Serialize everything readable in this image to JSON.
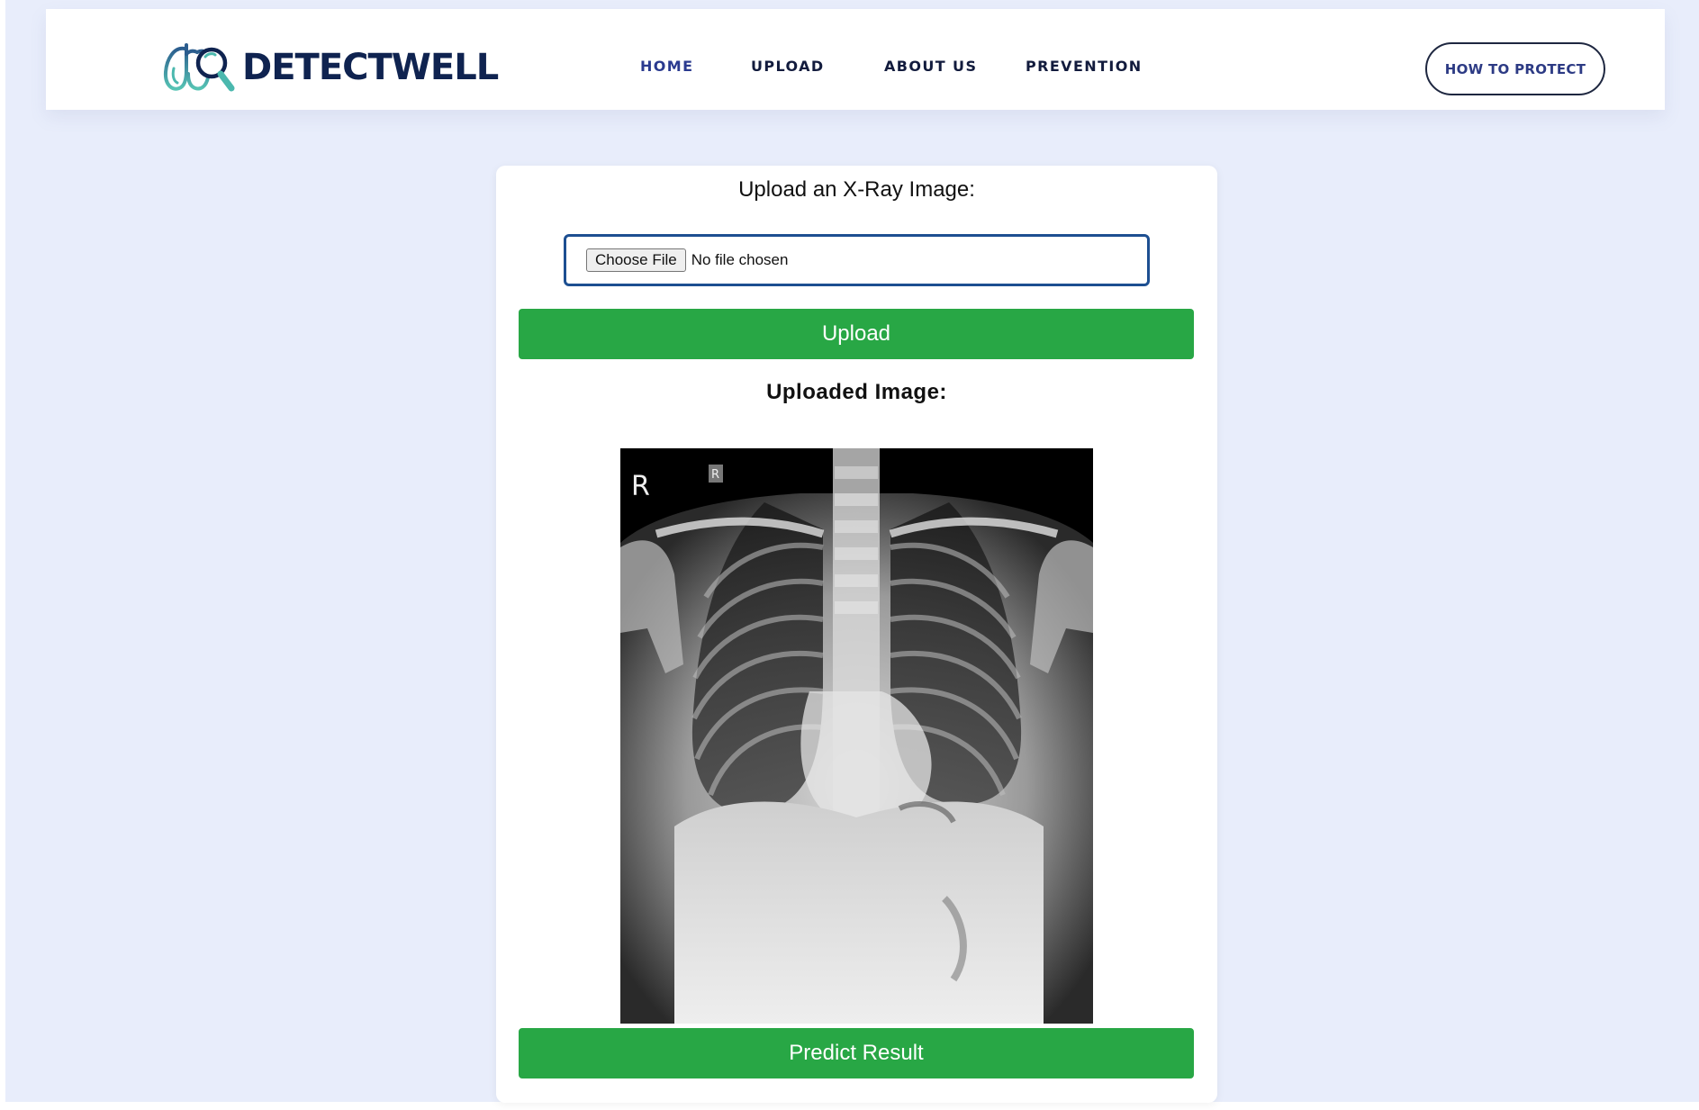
{
  "brand": {
    "name": "DETECTWELL",
    "logo_icon": "lungs-magnifier-logo"
  },
  "nav": {
    "items": [
      {
        "label": "HOME",
        "active": true
      },
      {
        "label": "UPLOAD",
        "active": false
      },
      {
        "label": "ABOUT US",
        "active": false
      },
      {
        "label": "PREVENTION",
        "active": false
      }
    ],
    "cta_label": "HOW TO PROTECT"
  },
  "upload_card": {
    "title": "Upload an X-Ray Image:",
    "file_input": {
      "button_label": "Choose File",
      "status": "No file chosen"
    },
    "upload_button": "Upload",
    "uploaded_title": "Uploaded Image:",
    "image": {
      "markers": [
        "R",
        "R"
      ]
    },
    "predict_button": "Predict Result"
  },
  "colors": {
    "page_background": "#e8edfb",
    "brand_navy": "#0f2350",
    "logo_teal": "#4bb8ae",
    "nav_active": "#2a3a8f",
    "button_green": "#28a745",
    "input_border": "#1d4f91"
  }
}
